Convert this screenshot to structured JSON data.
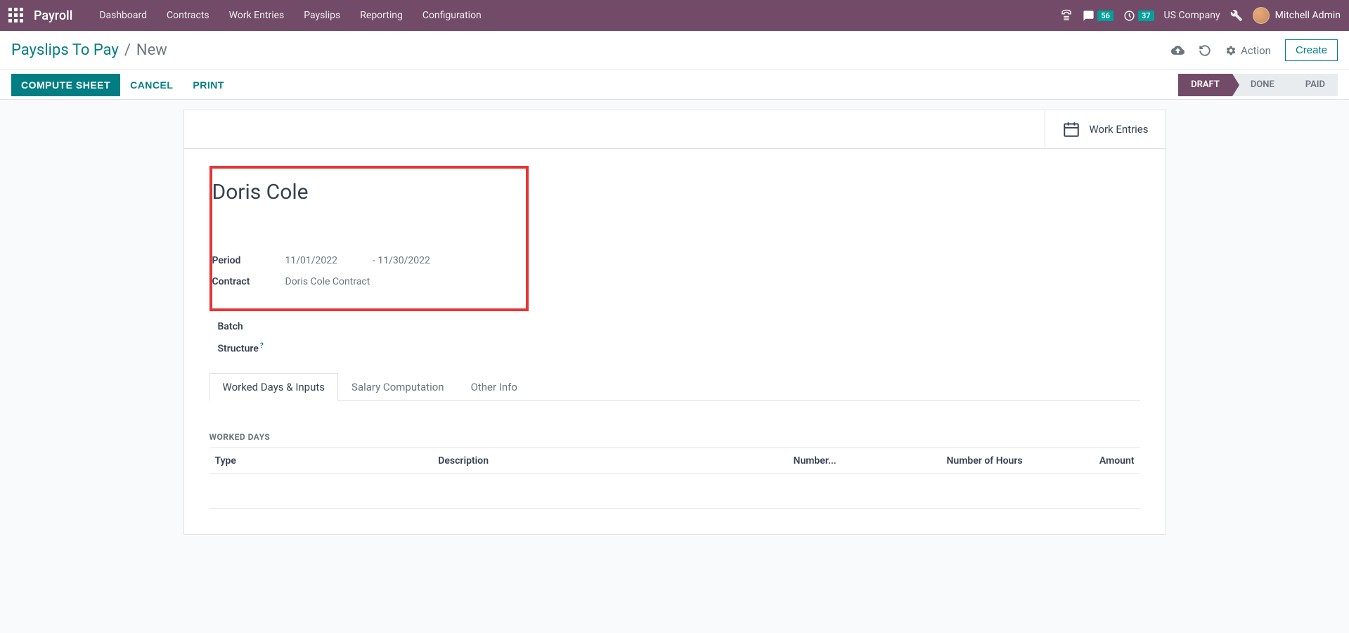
{
  "navbar": {
    "brand": "Payroll",
    "menu": [
      "Dashboard",
      "Contracts",
      "Work Entries",
      "Payslips",
      "Reporting",
      "Configuration"
    ],
    "messages_badge": "56",
    "activities_badge": "37",
    "company": "US Company",
    "user": "Mitchell Admin"
  },
  "breadcrumb": {
    "parent": "Payslips To Pay",
    "current": "New"
  },
  "control": {
    "action_label": "Action",
    "create_label": "Create"
  },
  "buttons": {
    "compute": "COMPUTE SHEET",
    "cancel": "CANCEL",
    "print": "PRINT"
  },
  "status_steps": [
    "DRAFT",
    "DONE",
    "PAID"
  ],
  "active_step_index": 0,
  "smart_button": {
    "label": "Work Entries"
  },
  "form": {
    "employee_name": "Doris Cole",
    "fields": {
      "period_label": "Period",
      "period_from": "11/01/2022",
      "period_to": "- 11/30/2022",
      "contract_label": "Contract",
      "contract_value": "Doris Cole Contract",
      "batch_label": "Batch",
      "batch_value": "",
      "structure_label": "Structure",
      "structure_value": ""
    }
  },
  "tabs": [
    "Worked Days & Inputs",
    "Salary Computation",
    "Other Info"
  ],
  "active_tab_index": 0,
  "worked_days": {
    "section_title": "WORKED DAYS",
    "columns": {
      "type": "Type",
      "description": "Description",
      "number": "Number...",
      "hours": "Number of Hours",
      "amount": "Amount"
    },
    "rows": []
  }
}
